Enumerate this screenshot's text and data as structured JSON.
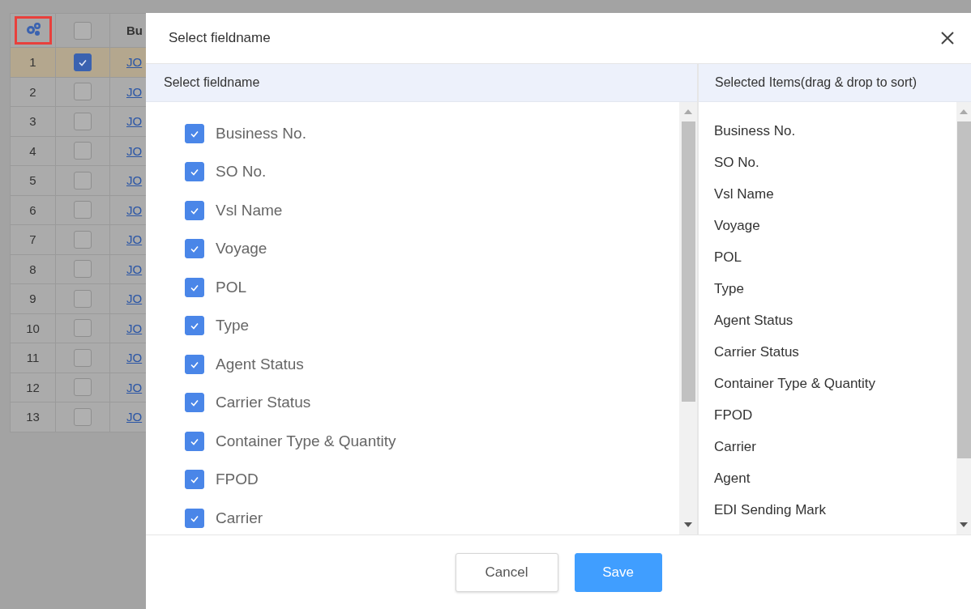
{
  "table": {
    "header": {
      "settings": true,
      "all_checked": false,
      "column_3": "Bu"
    },
    "rows": [
      {
        "index": "1",
        "checked": true,
        "selected": true,
        "link": "JO"
      },
      {
        "index": "2",
        "checked": false,
        "selected": false,
        "link": "JO"
      },
      {
        "index": "3",
        "checked": false,
        "selected": false,
        "link": "JO"
      },
      {
        "index": "4",
        "checked": false,
        "selected": false,
        "link": "JO"
      },
      {
        "index": "5",
        "checked": false,
        "selected": false,
        "link": "JO"
      },
      {
        "index": "6",
        "checked": false,
        "selected": false,
        "link": "JO"
      },
      {
        "index": "7",
        "checked": false,
        "selected": false,
        "link": "JO"
      },
      {
        "index": "8",
        "checked": false,
        "selected": false,
        "link": "JO"
      },
      {
        "index": "9",
        "checked": false,
        "selected": false,
        "link": "JO"
      },
      {
        "index": "10",
        "checked": false,
        "selected": false,
        "link": "JO"
      },
      {
        "index": "11",
        "checked": false,
        "selected": false,
        "link": "JO"
      },
      {
        "index": "12",
        "checked": false,
        "selected": false,
        "link": "JO"
      },
      {
        "index": "13",
        "checked": false,
        "selected": false,
        "link": "JO"
      }
    ]
  },
  "dialog": {
    "title": "Select fieldname",
    "left_panel": {
      "heading": "Select fieldname",
      "fields": [
        {
          "label": "Business No.",
          "checked": true
        },
        {
          "label": "SO No.",
          "checked": true
        },
        {
          "label": "Vsl Name",
          "checked": true
        },
        {
          "label": "Voyage",
          "checked": true
        },
        {
          "label": "POL",
          "checked": true
        },
        {
          "label": "Type",
          "checked": true
        },
        {
          "label": "Agent Status",
          "checked": true
        },
        {
          "label": "Carrier Status",
          "checked": true
        },
        {
          "label": "Container Type & Quantity",
          "checked": true
        },
        {
          "label": "FPOD",
          "checked": true
        },
        {
          "label": "Carrier",
          "checked": true
        }
      ]
    },
    "right_panel": {
      "heading": "Selected Items(drag & drop to sort)",
      "items": [
        "Business No.",
        "SO No.",
        "Vsl Name",
        "Voyage",
        "POL",
        "Type",
        "Agent Status",
        "Carrier Status",
        "Container Type & Quantity",
        "FPOD",
        "Carrier",
        "Agent",
        "EDI Sending Mark"
      ]
    },
    "buttons": [
      {
        "label": "Cancel",
        "kind": "secondary"
      },
      {
        "label": "Save",
        "kind": "primary"
      }
    ]
  }
}
